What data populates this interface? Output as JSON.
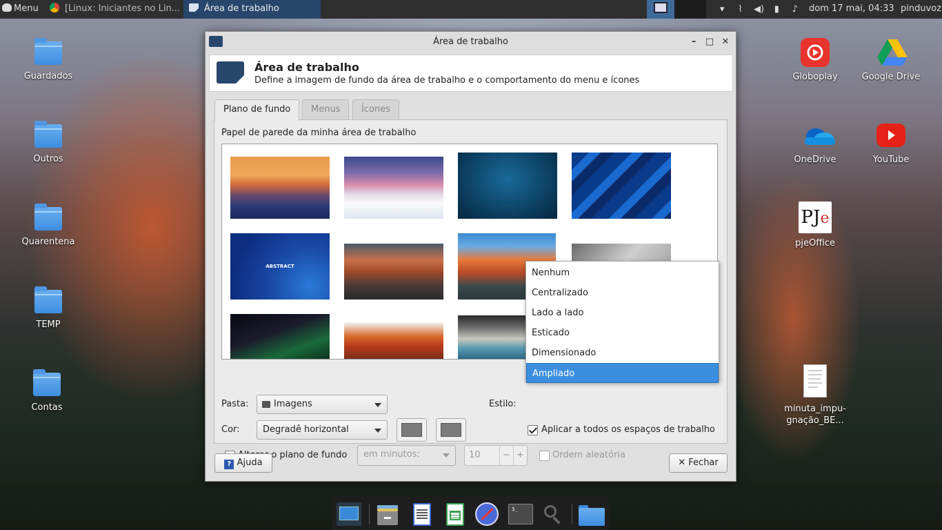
{
  "top_panel": {
    "menu_label": "Menu",
    "tasks": [
      {
        "label": "[Linux: Iniciantes no Lin..."
      },
      {
        "label": "Área de trabalho"
      }
    ],
    "clock": "dom 17 mai, 04:33",
    "user": "pinduvoz"
  },
  "desktop": {
    "left_icons": [
      {
        "label": "Guardados"
      },
      {
        "label": "Outros"
      },
      {
        "label": "Quarentena"
      },
      {
        "label": "TEMP"
      },
      {
        "label": "Contas"
      }
    ],
    "right_icons": [
      {
        "label": "Globoplay"
      },
      {
        "label": "Google Drive"
      },
      {
        "label": "OneDrive"
      },
      {
        "label": "YouTube"
      },
      {
        "label": "pjeOffice"
      },
      {
        "label": "minuta_impu-gnação_BE..."
      }
    ]
  },
  "dialog": {
    "title": "Área de trabalho",
    "header_title": "Área de trabalho",
    "header_subtitle": "Define a imagem de fundo da área de trabalho e o comportamento do menu e ícones",
    "tabs": [
      {
        "label": "Plano de fundo",
        "active": true
      },
      {
        "label": "Menus",
        "active": false
      },
      {
        "label": "Ícones",
        "active": false
      }
    ],
    "wallpaper_label": "Papel de parede da minha área de trabalho",
    "thumbnail_text": "ABSTRACT",
    "folder_label": "Pasta:",
    "folder_value": "Imagens",
    "style_label": "Estilo:",
    "color_label": "Cor:",
    "color_value": "Degradê horizontal",
    "color_1": "#7b7b7b",
    "color_2": "#7b7b7b",
    "apply_all_label": "Aplicar a todos os espaços de trabalho",
    "apply_all_checked": true,
    "change_bg_label": "Alterar o plano de fundo",
    "change_bg_checked": false,
    "interval_placeholder": "em minutos:",
    "interval_value": "10",
    "random_label": "Ordem aleatória",
    "help_button": "Ajuda",
    "close_button": "Fechar"
  },
  "style_dropdown": {
    "options": [
      "Nenhum",
      "Centralizado",
      "Lado a lado",
      "Esticado",
      "Dimensionado",
      "Ampliado"
    ],
    "selected": "Ampliado"
  },
  "dock": {
    "items": [
      "desktop-settings-icon",
      "file-manager-icon",
      "text-document-icon",
      "spreadsheet-icon",
      "web-browser-icon",
      "terminal-icon",
      "search-icon",
      "folder-icon"
    ]
  },
  "colors": {
    "panel_bg": "#2f2f2f",
    "active_task": "#28466b",
    "selection": "#3c8fe0"
  }
}
